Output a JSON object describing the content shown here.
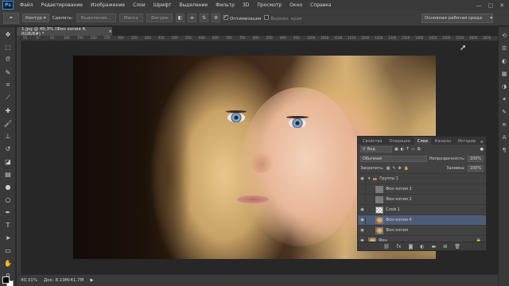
{
  "app": {
    "logo_text": "Ps"
  },
  "menu": [
    "Файл",
    "Редактирование",
    "Изображение",
    "Слои",
    "Шрифт",
    "Выделение",
    "Фильтр",
    "3D",
    "Просмотр",
    "Окно",
    "Справка"
  ],
  "window_buttons": [
    "—",
    "▢",
    "✕"
  ],
  "options_bar": {
    "mode_label": "Контур",
    "make_label": "Сделать:",
    "selection_btn": "Выделение...",
    "mask_btn": "Маска",
    "shape_btn": "Фигура",
    "autoalign_label": "Оптимизация",
    "align_edges_label": "Выровн. края",
    "workspace": "Основная рабочая среда"
  },
  "document": {
    "tab_title": "1.jpg @ 40,3% (Фон копия 4, RGB/8#) *",
    "tab_close": "×"
  },
  "ruler_ticks": [
    "50",
    "0",
    "50",
    "100",
    "150",
    "200",
    "250",
    "300",
    "350",
    "400",
    "450",
    "500",
    "550",
    "600",
    "650",
    "700",
    "750",
    "800",
    "850",
    "900",
    "950",
    "1000",
    "1050",
    "1100",
    "1150",
    "1200",
    "1250",
    "1300",
    "1350",
    "1400",
    "1450",
    "1500",
    "1550",
    "1600",
    "1650"
  ],
  "status": {
    "zoom": "40,31%",
    "doc_info": "Док: 8,19M/41,7M",
    "arrow": "▶"
  },
  "layers_panel": {
    "tabs": [
      "Свойства",
      "Операции",
      "Слои",
      "Каналы",
      "Истории"
    ],
    "active_tab": "Слои",
    "filter_label": "Вид",
    "blend_mode": "Обычные",
    "opacity_label": "Непрозрачность:",
    "opacity_value": "100%",
    "lock_label": "Закрепить:",
    "fill_label": "Заливка:",
    "fill_value": "100%",
    "layers": [
      {
        "name": "Группа 1",
        "thumb": "folder",
        "selected": false,
        "visible": true
      },
      {
        "name": "Фон копия 3",
        "thumb": "gray",
        "selected": false,
        "visible": false
      },
      {
        "name": "Фон копия 2",
        "thumb": "gray",
        "selected": false,
        "visible": false
      },
      {
        "name": "Слой 1",
        "thumb": "checker",
        "selected": false,
        "visible": true
      },
      {
        "name": "Фон копия 4",
        "thumb": "face",
        "selected": true,
        "visible": true
      },
      {
        "name": "Фон копия",
        "thumb": "face",
        "selected": false,
        "visible": true
      },
      {
        "name": "Фон",
        "thumb": "face",
        "selected": false,
        "visible": true,
        "locked": true
      }
    ],
    "footer_icons": [
      "link-icon",
      "fx-icon",
      "mask-icon",
      "adjustment-icon",
      "folder-icon",
      "new-layer-icon",
      "trash-icon"
    ]
  },
  "colors": {
    "foreground": "#000000",
    "background": "#ffffff",
    "selection": "#4e5d77"
  }
}
